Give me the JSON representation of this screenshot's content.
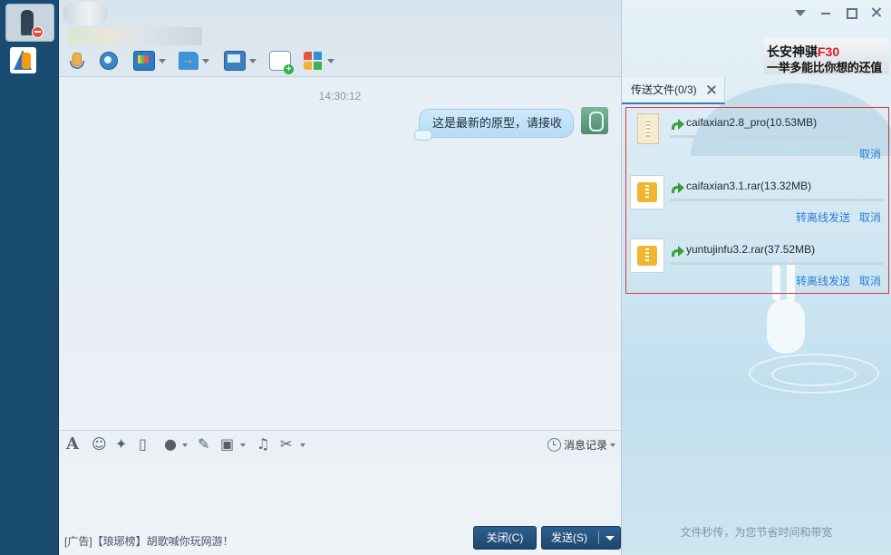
{
  "header": {
    "toolbar": [
      {
        "name": "mic-icon",
        "has_menu": false
      },
      {
        "name": "camera-icon",
        "has_menu": false
      },
      {
        "name": "screen-share-icon",
        "has_menu": true
      },
      {
        "name": "send-file-icon",
        "has_menu": true
      },
      {
        "name": "remote-desktop-icon",
        "has_menu": true
      },
      {
        "name": "create-discussion-icon",
        "has_menu": false
      },
      {
        "name": "apps-icon",
        "has_menu": true
      }
    ]
  },
  "messages": {
    "timestamp": "14:30:12",
    "items": [
      {
        "from": "me",
        "text": "这是最新的原型，请接收"
      }
    ]
  },
  "input_toolbar": {
    "icons": [
      "font-icon",
      "emoji-icon",
      "magic-wand-icon",
      "vibrate-icon",
      "voice-message-icon",
      "edit-icon",
      "image-icon",
      "music-icon",
      "scissors-icon"
    ],
    "history_label": "消息记录"
  },
  "footer": {
    "ad_text": "[广告]【琅琊榜】胡歌喊你玩网游！",
    "close_label": "关闭(C)",
    "send_label": "发送(S)"
  },
  "right_panel": {
    "ad": {
      "line1_prefix": "长安神骐",
      "line1_model": "F30",
      "line2": "一举多能比你想的还值"
    },
    "tab_label": "传送文件(0/3)",
    "files": [
      {
        "name": "caifaxian2.8_pro(10.53MB)",
        "type": "folder",
        "progress": 0,
        "actions": [
          "取消"
        ]
      },
      {
        "name": "caifaxian3.1.rar(13.32MB)",
        "type": "zip",
        "progress": 0,
        "actions": [
          "转离线发送",
          "取消"
        ]
      },
      {
        "name": "yuntujinfu3.2.rar(37.52MB)",
        "type": "zip",
        "progress": 0,
        "actions": [
          "转离线发送",
          "取消"
        ]
      }
    ],
    "footer_text": "文件秒传，为您节省时间和带宽"
  },
  "colors": {
    "accent": "#2c7ed6",
    "sidebar": "#1a4c72",
    "highlight_border": "#e3363b"
  }
}
